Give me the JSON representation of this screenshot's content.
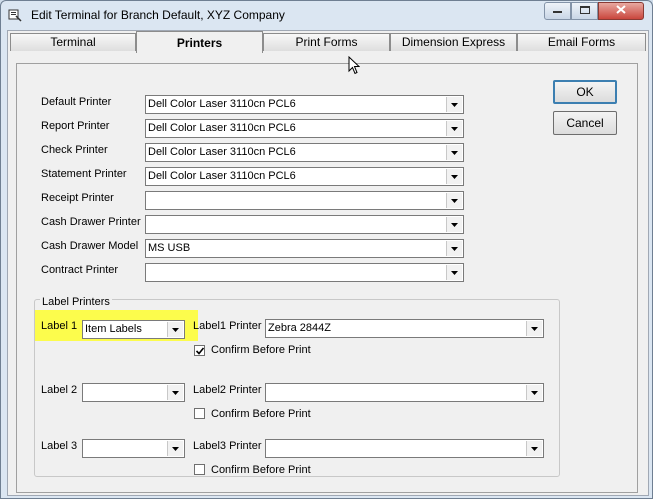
{
  "window": {
    "title": "Edit Terminal  for Branch Default, XYZ Company",
    "icon": "terminal-app-icon"
  },
  "tabs": [
    {
      "label": "Terminal",
      "active": false
    },
    {
      "label": "Printers",
      "active": true
    },
    {
      "label": "Print Forms",
      "active": false
    },
    {
      "label": "Dimension Express",
      "active": false
    },
    {
      "label": "Email Forms",
      "active": false
    }
  ],
  "buttons": {
    "ok": "OK",
    "cancel": "Cancel"
  },
  "printers": [
    {
      "label": "Default Printer",
      "value": "Dell Color Laser 3110cn PCL6"
    },
    {
      "label": "Report Printer",
      "value": "Dell Color Laser 3110cn PCL6"
    },
    {
      "label": "Check Printer",
      "value": "Dell Color Laser 3110cn PCL6"
    },
    {
      "label": "Statement Printer",
      "value": "Dell Color Laser 3110cn PCL6"
    },
    {
      "label": "Receipt Printer",
      "value": ""
    },
    {
      "label": "Cash Drawer Printer",
      "value": ""
    },
    {
      "label": "Cash Drawer Model",
      "value": "MS USB"
    },
    {
      "label": "Contract Printer",
      "value": ""
    }
  ],
  "label_printers": {
    "title": "Label Printers",
    "rows": [
      {
        "label": "Label 1",
        "type_value": "Item Labels",
        "printer_label": "Label1 Printer",
        "printer_value": "Zebra 2844Z",
        "confirm_label": "Confirm Before Print",
        "confirm_checked": true
      },
      {
        "label": "Label 2",
        "type_value": "",
        "printer_label": "Label2 Printer",
        "printer_value": "",
        "confirm_label": "Confirm Before Print",
        "confirm_checked": false
      },
      {
        "label": "Label 3",
        "type_value": "",
        "printer_label": "Label3 Printer",
        "printer_value": "",
        "confirm_label": "Confirm Before Print",
        "confirm_checked": false
      }
    ]
  },
  "colors": {
    "highlight": "#fcfc4c",
    "window_frame": "#dbe6f2",
    "close_button": "#c9463d"
  }
}
